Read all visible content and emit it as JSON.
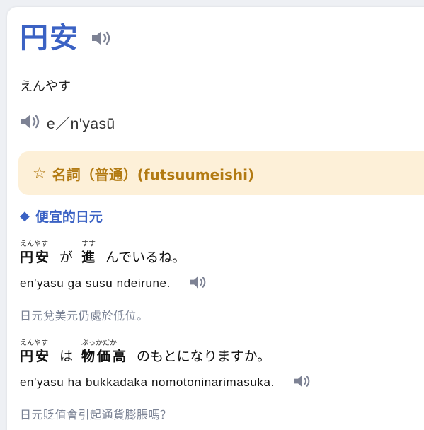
{
  "word": {
    "title": "円安",
    "reading": "えんやす",
    "pronunciation": "e／n'yasū",
    "speaker_icon": "speaker-icon"
  },
  "part_of_speech": {
    "star": "☆",
    "label": "名詞（普通）(futsuumeishi)"
  },
  "meaning": {
    "marker": "◆",
    "text": "便宜的日元"
  },
  "examples": [
    {
      "segments": [
        {
          "ruby": "えんやす",
          "base": "円安",
          "kanji": true
        },
        {
          "ruby": "",
          "base": "が",
          "kanji": false
        },
        {
          "ruby": "すす",
          "base": "進",
          "kanji": true
        },
        {
          "ruby": "",
          "base": "んでいるね。",
          "kanji": false
        }
      ],
      "romaji": "en'yasu ga susu ndeirune.",
      "translation": "日元兌美元仍處於低位。"
    },
    {
      "segments": [
        {
          "ruby": "えんやす",
          "base": "円安",
          "kanji": true
        },
        {
          "ruby": "",
          "base": "は",
          "kanji": false
        },
        {
          "ruby": "ぶっかだか",
          "base": "物価高",
          "kanji": true
        },
        {
          "ruby": "",
          "base": "のもとになりますか。",
          "kanji": false
        }
      ],
      "romaji": "en'yasu ha bukkadaka nomotoninarimasuka.",
      "translation": "日元貶值會引起通貨膨脹嗎？"
    }
  ],
  "colors": {
    "accent_blue": "#3b62c4",
    "pos_background": "#fdf0d8",
    "pos_text": "#b27a12",
    "translation_gray": "#7a8294",
    "icon_gray": "#7d8294"
  }
}
